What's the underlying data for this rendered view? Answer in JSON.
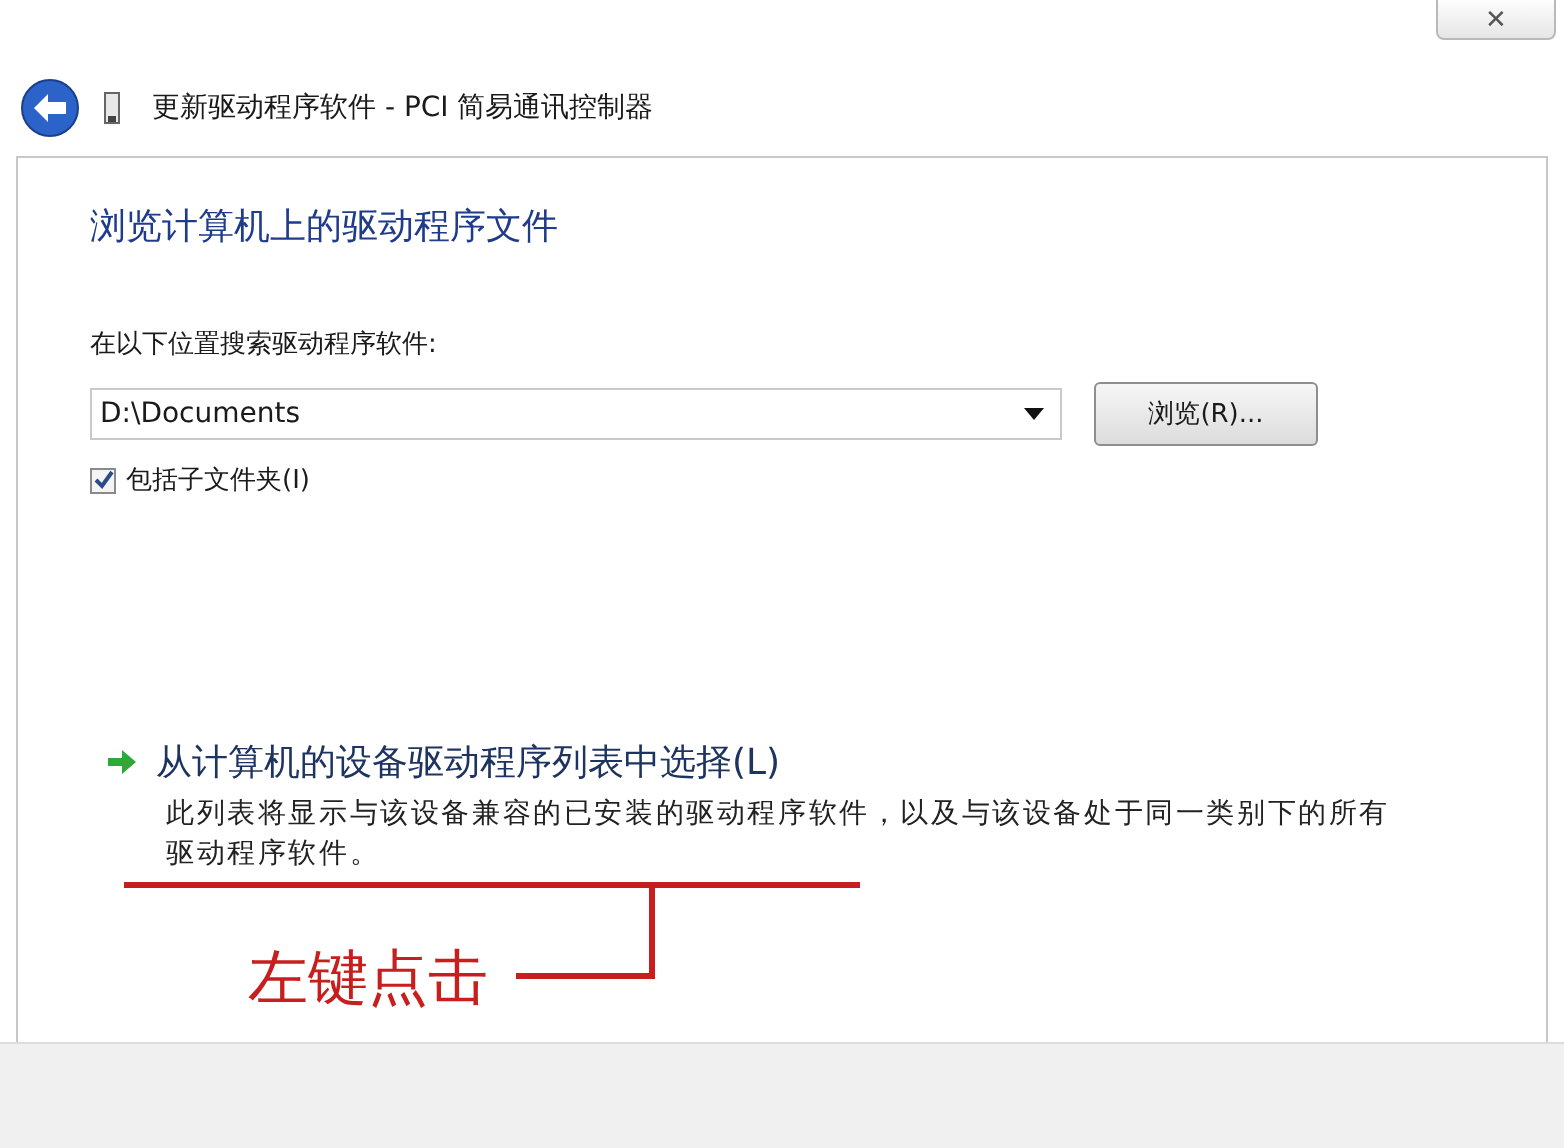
{
  "window": {
    "close_button": "✕"
  },
  "header": {
    "title": "更新驱动程序软件 - PCI 简易通讯控制器"
  },
  "heading": "浏览计算机上的驱动程序文件",
  "search": {
    "label": "在以下位置搜索驱动程序软件:",
    "value": "D:\\Documents",
    "browse_button": "浏览(R)..."
  },
  "include_subfolders": {
    "label": "包括子文件夹(I)",
    "checked": true
  },
  "option": {
    "title": "从计算机的设备驱动程序列表中选择(L)",
    "description": "此列表将显示与该设备兼容的已安装的驱动程序软件，以及与该设备处于同一类别下的所有驱动程序软件。"
  },
  "annotation": {
    "text": "左键点击"
  }
}
